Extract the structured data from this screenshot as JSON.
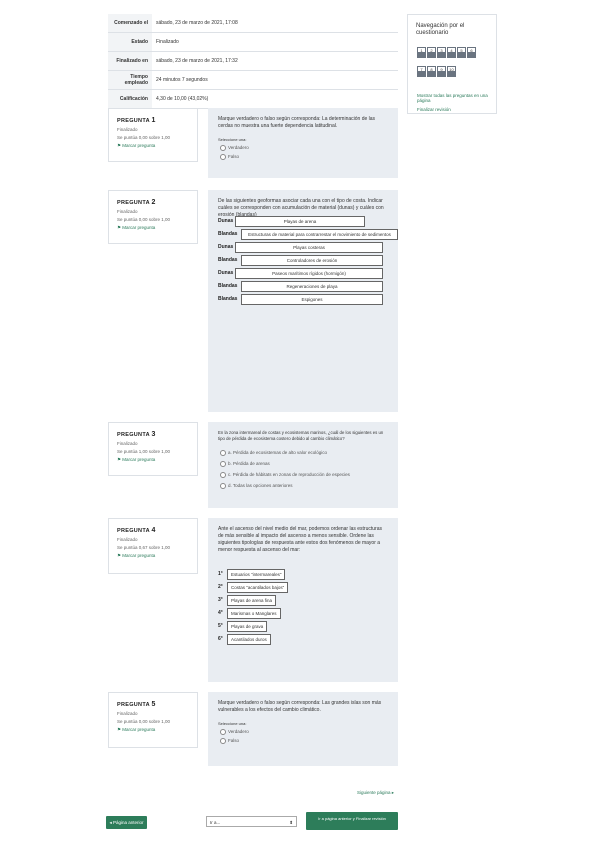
{
  "summary": {
    "rows": [
      {
        "label": "Comenzado el",
        "value": "sábado, 23 de marzo de 2021, 17:08"
      },
      {
        "label": "Estado",
        "value": "Finalizado"
      },
      {
        "label": "Finalizado en",
        "value": "sábado, 23 de marzo de 2021, 17:32"
      },
      {
        "label": "Tiempo empleado",
        "value": "24 minutos 7 segundos"
      },
      {
        "label": "Calificación",
        "value": "4,30 de 10,00 (43,02%)"
      }
    ]
  },
  "nav": {
    "title": "Navegación por el cuestionario",
    "buttons": [
      "1",
      "2",
      "3",
      "4",
      "5",
      "6",
      "7",
      "8",
      "9",
      "10"
    ],
    "show_all": "Mostrar todas las preguntas en una página",
    "finish_review": "Finalizar revisión"
  },
  "questions": [
    {
      "label": "PREGUNTA",
      "num": "1",
      "state": "Finalizado",
      "mark": "Se puntúa 0,00 sobre 1,00",
      "flag": "Marcar pregunta",
      "text": "Marque verdadero o falso según corresponda: La determinación de las cerdas no muestra una fuerte dependencia latitudinal.",
      "select_label": "Seleccione una:",
      "options": [
        "Verdadero",
        "Falso"
      ]
    },
    {
      "label": "PREGUNTA",
      "num": "2",
      "state": "Finalizado",
      "mark": "Se puntúa 0,00 sobre 1,00",
      "flag": "Marcar pregunta",
      "text": "De las siguientes geoformas asociar cada una con el tipo de costa. Indicar cuáles se corresponden con acumulación de material (dunas) y cuáles con erosión (blandas)",
      "pairs": [
        {
          "left": "Dunas",
          "right": "Playas de arena"
        },
        {
          "left": "Blandas",
          "right": "Estructuras de material para contrarrestar el movimiento de sedimentos"
        },
        {
          "left": "Dunas",
          "right": "Playas costeras"
        },
        {
          "left": "Blandas",
          "right": "Controladores de erosión"
        },
        {
          "left": "Dunas",
          "right": "Paseos marítimos rígidos (hormigón)"
        },
        {
          "left": "Blandas",
          "right": "Regeneraciones de playa"
        },
        {
          "left": "Blandas",
          "right": "Espigones"
        }
      ]
    },
    {
      "label": "PREGUNTA",
      "num": "3",
      "state": "Finalizado",
      "mark": "Se puntúa 1,00 sobre 1,00",
      "flag": "Marcar pregunta",
      "text": "En la zona intermareal de costas y ecosistemas marinos, ¿cuál de los siguientes es un tipo de pérdida de ecosistema costero debido al cambio climático?",
      "options": [
        "a. Pérdida de ecosistemas de alto valor ecológico",
        "b. Pérdida de arenas",
        "c. Pérdida de hábitats en zonas de reproducción de especies",
        "d. Todas las opciones anteriores"
      ]
    },
    {
      "label": "PREGUNTA",
      "num": "4",
      "state": "Finalizado",
      "mark": "Se puntúa 0,67 sobre 1,00",
      "flag": "Marcar pregunta",
      "text": "Ante el ascenso del nivel medio del mar, podemos ordenar las estructuras de más sensible al impacto del ascenso a menos sensible. Ordene las siguientes tipologías de respuesta ante estos dos fenómenos de mayor a menor respuesta al ascenso del mar:",
      "order": [
        {
          "n": "1°",
          "v": "Estuarios \"intermareales\""
        },
        {
          "n": "2°",
          "v": "Costas \"acantilados bajos\""
        },
        {
          "n": "3°",
          "v": "Playas de arena fina"
        },
        {
          "n": "4°",
          "v": "Marismas o Manglares"
        },
        {
          "n": "5°",
          "v": "Playas de grava"
        },
        {
          "n": "6°",
          "v": "Acantilados duros"
        }
      ]
    },
    {
      "label": "PREGUNTA",
      "num": "5",
      "state": "Finalizado",
      "mark": "Se puntúa 0,00 sobre 1,00",
      "flag": "Marcar pregunta",
      "text": "Marque verdadero o falso según corresponda: Las grandes islas son más vulnerables a los efectos del cambio climático.",
      "select_label": "Seleccione una:",
      "options": [
        "Verdadero",
        "Falso"
      ]
    }
  ],
  "footer": {
    "next_page": "Siguiente página",
    "prev": "Página anterior",
    "jump": "Ir a...",
    "next_button": "Ir a página anterior y Finalizar revisión"
  }
}
